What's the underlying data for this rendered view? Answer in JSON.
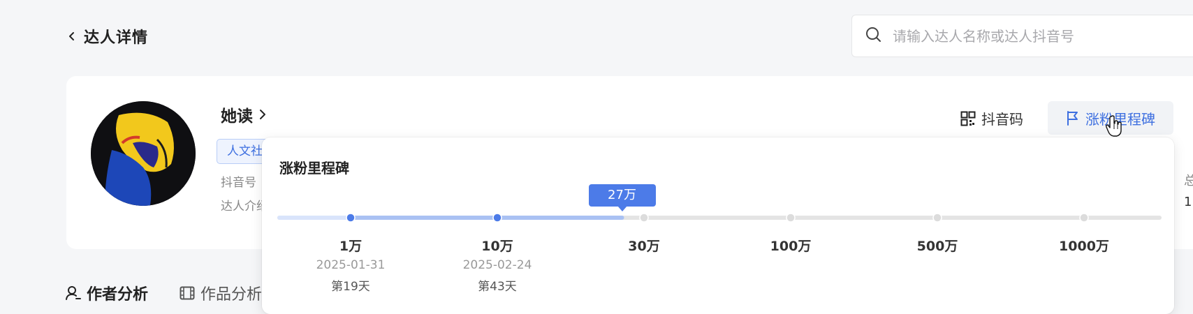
{
  "header": {
    "title": "达人详情",
    "search_placeholder": "请输入达人名称或达人抖音号"
  },
  "profile": {
    "name": "她读",
    "tag": "人文社",
    "meta_1_label": "抖音号",
    "meta_2_label": "达人介绍",
    "actions": {
      "douyin_code": "抖音码",
      "milestone": "涨粉里程碑"
    },
    "right_fragment_1": "总",
    "right_fragment_2": "1"
  },
  "tabs": [
    {
      "label": "作者分析",
      "active": true
    },
    {
      "label": "作品分析",
      "active": false
    }
  ],
  "milestone_popover": {
    "title": "涨粉里程碑",
    "current_label": "27万",
    "current_value_wan": 27,
    "milestones": [
      {
        "label": "1万",
        "date": "2025-01-31",
        "day": "第19天",
        "reached": true
      },
      {
        "label": "10万",
        "date": "2025-02-24",
        "day": "第43天",
        "reached": true
      },
      {
        "label": "30万",
        "date": "",
        "day": "",
        "reached": false
      },
      {
        "label": "100万",
        "date": "",
        "day": "",
        "reached": false
      },
      {
        "label": "500万",
        "date": "",
        "day": "",
        "reached": false
      },
      {
        "label": "1000万",
        "date": "",
        "day": "",
        "reached": false
      }
    ],
    "colors": {
      "accent": "#4c7be8",
      "track_reached_light": "#d9e4fb",
      "track_reached": "#a9c1f3",
      "track_unreached": "#e4e4e4",
      "dot_unreached": "#dcdcdc"
    }
  }
}
